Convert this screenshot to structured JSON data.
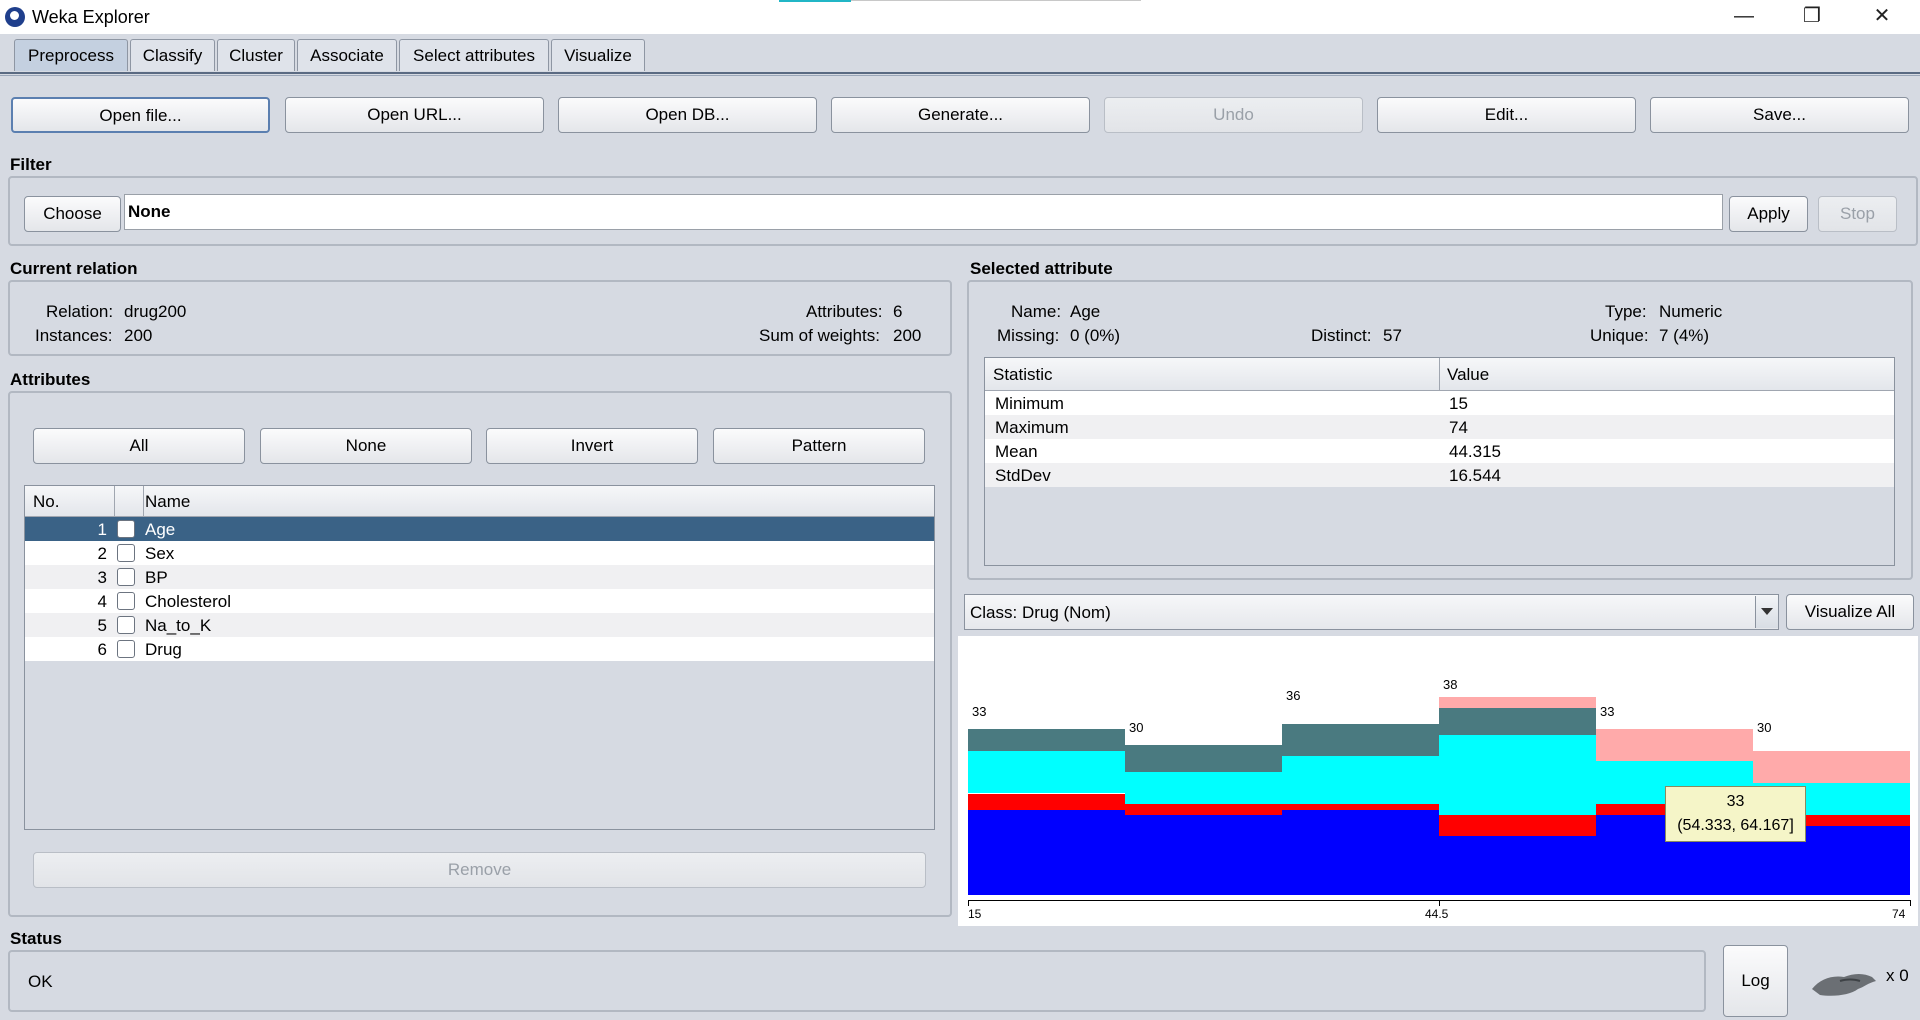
{
  "window": {
    "title": "Weka Explorer",
    "minimize_glyph": "—",
    "restore_glyph": "❐",
    "close_glyph": "✕"
  },
  "tabs": [
    {
      "label": "Preprocess"
    },
    {
      "label": "Classify"
    },
    {
      "label": "Cluster"
    },
    {
      "label": "Associate"
    },
    {
      "label": "Select attributes"
    },
    {
      "label": "Visualize"
    }
  ],
  "toolbar": {
    "open_file": "Open file...",
    "open_url": "Open URL...",
    "open_db": "Open DB...",
    "generate": "Generate...",
    "undo": "Undo",
    "edit": "Edit...",
    "save": "Save..."
  },
  "filter": {
    "section_label": "Filter",
    "choose_label": "Choose",
    "value": "None",
    "apply_label": "Apply",
    "stop_label": "Stop"
  },
  "relation": {
    "section_label": "Current relation",
    "relation_label": "Relation:",
    "relation_value": "drug200",
    "instances_label": "Instances:",
    "instances_value": "200",
    "attributes_label": "Attributes:",
    "attributes_value": "6",
    "weights_label": "Sum of weights:",
    "weights_value": "200"
  },
  "attributes": {
    "section_label": "Attributes",
    "all_label": "All",
    "none_label": "None",
    "invert_label": "Invert",
    "pattern_label": "Pattern",
    "col_no": "No.",
    "col_name": "Name",
    "rows": [
      {
        "no": "1",
        "name": "Age",
        "selected": true
      },
      {
        "no": "2",
        "name": "Sex"
      },
      {
        "no": "3",
        "name": "BP"
      },
      {
        "no": "4",
        "name": "Cholesterol"
      },
      {
        "no": "5",
        "name": "Na_to_K"
      },
      {
        "no": "6",
        "name": "Drug"
      }
    ],
    "remove_label": "Remove"
  },
  "selected_attribute": {
    "section_label": "Selected attribute",
    "name_label": "Name:",
    "name_value": "Age",
    "type_label": "Type:",
    "type_value": "Numeric",
    "missing_label": "Missing:",
    "missing_value": "0 (0%)",
    "distinct_label": "Distinct:",
    "distinct_value": "57",
    "unique_label": "Unique:",
    "unique_value": "7 (4%)",
    "col_statistic": "Statistic",
    "col_value": "Value",
    "stats": [
      {
        "statistic": "Minimum",
        "value": "15"
      },
      {
        "statistic": "Maximum",
        "value": "74"
      },
      {
        "statistic": "Mean",
        "value": "44.315"
      },
      {
        "statistic": "StdDev",
        "value": "16.544"
      }
    ]
  },
  "class_select": {
    "value": "Class: Drug (Nom)",
    "visualize_all_label": "Visualize All"
  },
  "chart_data": {
    "type": "bar",
    "stacked": true,
    "xlim": [
      15,
      74
    ],
    "bins": [
      [
        15,
        24.833
      ],
      [
        24.833,
        34.667
      ],
      [
        34.667,
        44.5
      ],
      [
        44.5,
        54.333
      ],
      [
        54.333,
        64.167
      ],
      [
        64.167,
        74
      ]
    ],
    "totals": [
      33,
      30,
      36,
      38,
      33,
      30
    ],
    "axis_labels": [
      "15",
      "44.5",
      "74"
    ],
    "colors": [
      "#0000ff",
      "#ff0000",
      "#00ffff",
      "#4a7a80",
      "#ffaaaa"
    ],
    "series": [
      {
        "color": "#0000ff",
        "values": [
          16,
          15,
          16,
          11,
          15,
          13
        ]
      },
      {
        "color": "#ff0000",
        "values": [
          3,
          2,
          1,
          4,
          2,
          2
        ]
      },
      {
        "color": "#00ffff",
        "values": [
          8,
          6,
          9,
          15,
          8,
          6
        ]
      },
      {
        "color": "#4a7a80",
        "values": [
          4,
          5,
          6,
          5,
          0,
          0
        ]
      },
      {
        "color": "#ffaaaa",
        "values": [
          0,
          0,
          0,
          2,
          6,
          6
        ]
      }
    ],
    "tooltip": {
      "count": "33",
      "range": "(54.333, 64.167]"
    }
  },
  "status": {
    "section_label": "Status",
    "text": "OK",
    "log_label": "Log",
    "count": "x 0"
  }
}
